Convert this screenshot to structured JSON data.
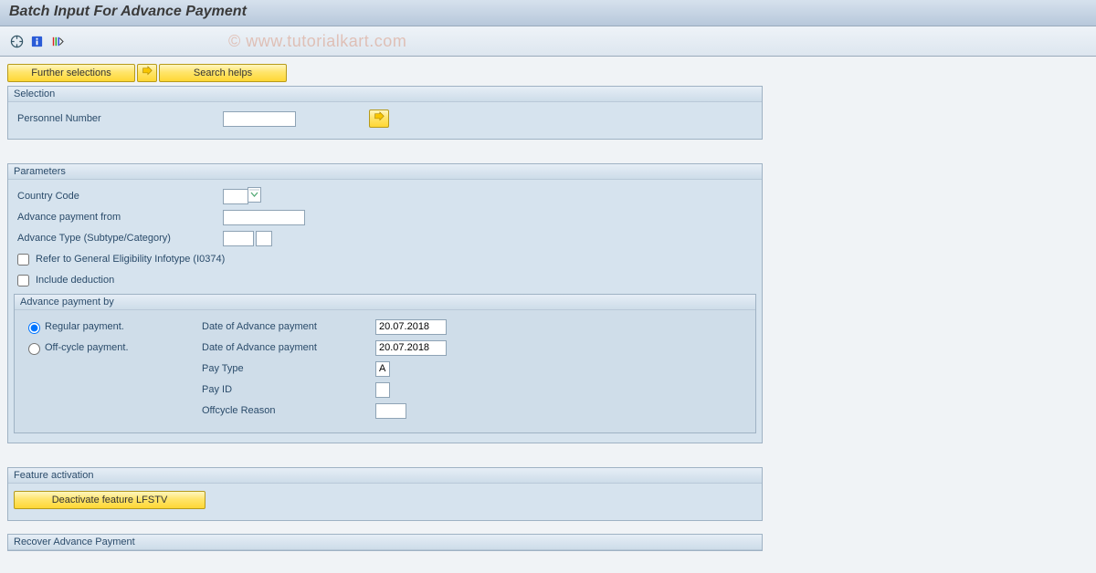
{
  "page_title": "Batch Input For Advance Payment",
  "watermark": "© www.tutorialkart.com",
  "top_buttons": {
    "further": "Further selections",
    "search": "Search helps"
  },
  "selection": {
    "title": "Selection",
    "personnel_label": "Personnel Number",
    "personnel_value": ""
  },
  "parameters": {
    "title": "Parameters",
    "country_label": "Country Code",
    "country_value": "",
    "adv_from_label": "Advance payment from",
    "adv_from_value": "",
    "adv_type_label": "Advance Type (Subtype/Category)",
    "adv_type_sub": "",
    "adv_type_cat": "",
    "refer_label": "Refer to General Eligibility Infotype (I0374)",
    "include_label": "Include deduction",
    "adv_by": {
      "title": "Advance payment by",
      "regular_label": "Regular payment.",
      "offcycle_label": "Off-cycle payment.",
      "date1_label": "Date of Advance payment",
      "date1_value": "20.07.2018",
      "date2_label": "Date of Advance payment",
      "date2_value": "20.07.2018",
      "paytype_label": "Pay Type",
      "paytype_value": "A",
      "payid_label": "Pay ID",
      "payid_value": "",
      "offreason_label": "Offcycle Reason",
      "offreason_value": ""
    }
  },
  "feature": {
    "title": "Feature activation",
    "button": "Deactivate feature LFSTV"
  },
  "recover": {
    "title": "Recover Advance Payment"
  }
}
